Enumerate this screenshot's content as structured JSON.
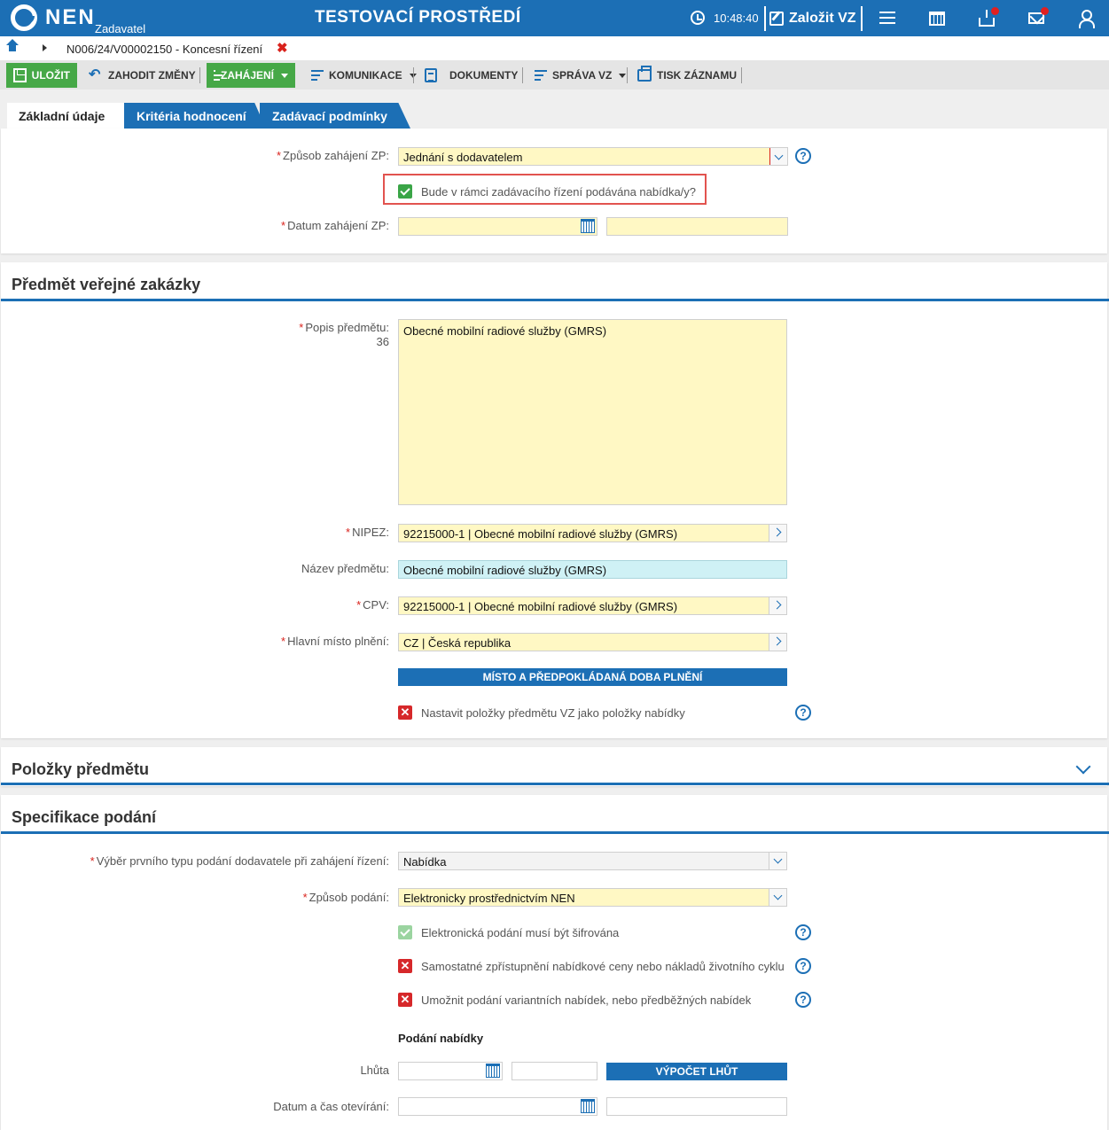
{
  "header": {
    "logo": "NEN",
    "logo_sub": "Zadavatel",
    "env_title": "TESTOVACÍ PROSTŘEDÍ",
    "time": "10:48:40",
    "create_label": "Založit VZ"
  },
  "breadcrumb": {
    "text": "N006/24/V00002150 - Koncesní řízení",
    "close": "✖"
  },
  "toolbar": {
    "save": "ULOŽIT",
    "discard": "ZAHODIT ZMĚNY",
    "start": "ZAHÁJENÍ",
    "communication": "KOMUNIKACE",
    "documents": "DOKUMENTY",
    "management": "SPRÁVA VZ",
    "print": "TISK ZÁZNAMU"
  },
  "tabs": [
    "Základní údaje",
    "Kritéria hodnocení",
    "Zadávací podmínky"
  ],
  "basic": {
    "start_method_label": "Způsob zahájení ZP:",
    "start_method_value": "Jednání s dodavatelem",
    "offer_checkbox_label": "Bude v rámci zadávacího řízení podávána nabídka/y?",
    "start_date_label": "Datum zahájení ZP:",
    "start_date_value": "",
    "start_time_value": ""
  },
  "subject": {
    "title": "Předmět veřejné zakázky",
    "desc_label": "Popis předmětu:",
    "desc_count": "36",
    "desc_value": "Obecné mobilní radiové služby (GMRS)",
    "nipez_label": "NIPEZ:",
    "nipez_value": "92215000-1 | Obecné mobilní radiové služby (GMRS)",
    "name_label": "Název předmětu:",
    "name_value": "Obecné mobilní radiové služby (GMRS)",
    "cpv_label": "CPV:",
    "cpv_value": "92215000-1 | Obecné mobilní radiové služby (GMRS)",
    "place_label": "Hlavní místo plnění:",
    "place_value": "CZ | Česká republika",
    "place_button": "MÍSTO A PŘEDPOKLÁDANÁ DOBA PLNĚNÍ",
    "items_checkbox_label": "Nastavit položky předmětu VZ jako položky nabídky"
  },
  "items": {
    "title": "Položky předmětu"
  },
  "submission": {
    "title": "Specifikace podání",
    "first_type_label": "Výběr prvního typu podání dodavatele při zahájení řízení:",
    "first_type_value": "Nabídka",
    "method_label": "Způsob podání:",
    "method_value": "Elektronicky prostřednictvím NEN",
    "encrypted_label": "Elektronická podání musí být šifrována",
    "separate_price_label": "Samostatné zpřístupnění nabídkové ceny nebo nákladů životního cyklu",
    "variant_label": "Umožnit podání variantních nabídek, nebo předběžných nabídek",
    "offer_subhead": "Podání nabídky",
    "deadline_label": "Lhůta",
    "calc_button": "VÝPOČET LHŮT",
    "opening_label": "Datum a čas otevírání:"
  },
  "help_glyph": "?",
  "x_glyph": "✕",
  "colors": {
    "brand_blue": "#1c6fb5",
    "green": "#46a847",
    "required_red": "#d9221c",
    "input_yellow": "#fff8c4",
    "input_cyan": "#cff1f5"
  }
}
